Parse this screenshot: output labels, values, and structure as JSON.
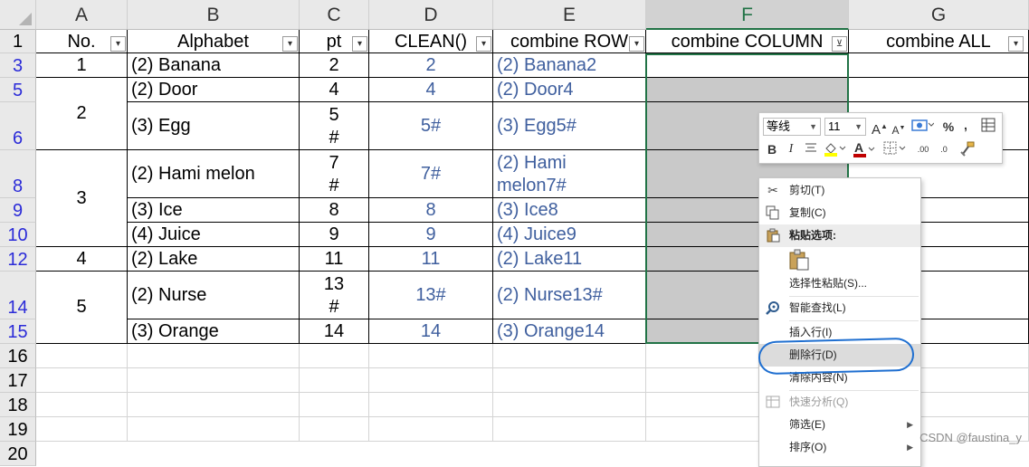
{
  "columns": [
    {
      "letter": "A"
    },
    {
      "letter": "B"
    },
    {
      "letter": "C"
    },
    {
      "letter": "D"
    },
    {
      "letter": "E"
    },
    {
      "letter": "F"
    },
    {
      "letter": "G"
    }
  ],
  "rows": [
    "1",
    "3",
    "5",
    "6",
    "8",
    "9",
    "10",
    "12",
    "14",
    "15",
    "16",
    "17",
    "18",
    "19",
    "20"
  ],
  "headers": {
    "A": "No.",
    "B": "Alphabet",
    "C": "pt",
    "D": "CLEAN()",
    "E": "combine ROW",
    "F": "combine COLUMN",
    "G": "combine ALL"
  },
  "filter_glyph": "▾",
  "filter_active_glyph": "⊻",
  "cells": {
    "A3": "1",
    "A5": "2",
    "A8": "3",
    "A12": "4",
    "A14": "5",
    "B3": "(2) Banana",
    "B5": "(2) Door",
    "B6": "(3) Egg",
    "B8": "(2) Hami melon",
    "B9": "(3) Ice",
    "B10": "(4) Juice",
    "B12": "(2) Lake",
    "B14": "(2) Nurse",
    "B15": "(3) Orange",
    "C3": "2",
    "C5": "4",
    "C6a": "5",
    "C6b": "#",
    "C8a": "7",
    "C8b": "#",
    "C9": "8",
    "C10": "9",
    "C12": "11",
    "C14a": "13",
    "C14b": "#",
    "C15": "14",
    "D3": "2",
    "D5": "4",
    "D6": "5#",
    "D8": "7#",
    "D9": "8",
    "D10": "9",
    "D12": "11",
    "D14": "13#",
    "D15": "14",
    "E3": "(2) Banana2",
    "E5": "(2) Door4",
    "E6": "(3) Egg5#",
    "E8a": "(2) Hami",
    "E8b": "melon7#",
    "E9": "(3) Ice8",
    "E10": "(4) Juice9",
    "E12": "(2) Lake11",
    "E14": "(2) Nurse13#",
    "E15": "(3) Orange14"
  },
  "mini_toolbar": {
    "font": "等线",
    "size": "11",
    "grow_font": "A",
    "shrink_font": "A",
    "percent": "%",
    "comma": ",",
    "bold": "B",
    "italic": "I",
    "font_color": "A",
    "dec_increase": ".00",
    "dec_decrease": ".0"
  },
  "context_menu": {
    "items": [
      {
        "label": "剪切(T)",
        "icon": "scissors-icon"
      },
      {
        "label": "复制(C)",
        "icon": "copy-icon"
      },
      {
        "label": "粘贴选项:",
        "icon": "paste-icon"
      },
      {
        "label": "选择性粘贴(S)...",
        "icon": ""
      },
      {
        "label": "智能查找(L)",
        "icon": "smart-lookup-icon"
      },
      {
        "label": "插入行(I)",
        "icon": ""
      },
      {
        "label": "删除行(D)",
        "icon": ""
      },
      {
        "label": "清除内容(N)",
        "icon": ""
      },
      {
        "label": "快速分析(Q)",
        "icon": "quick-analysis-icon"
      },
      {
        "label": "筛选(E)",
        "icon": ""
      },
      {
        "label": "排序(O)",
        "icon": ""
      }
    ]
  },
  "watermark": "CSDN @faustina_y",
  "colors": {
    "selection_green": "#217346",
    "row_number_blue": "#2b2bd8",
    "value_blue": "#3f5f9e",
    "annotation_blue": "#1f6fd0",
    "selected_fill": "#c9c9c9"
  }
}
